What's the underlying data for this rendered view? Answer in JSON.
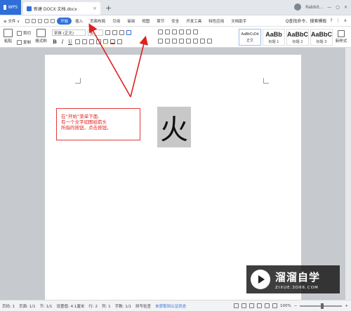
{
  "tabs": {
    "app_label": "WPS",
    "doc_label": "新建 DOCX 文档.docx",
    "close_glyph": "×",
    "add_glyph": "+"
  },
  "window": {
    "user": "Rabbit...",
    "restore_glyph": "▢",
    "minimize_glyph": "—",
    "close_glyph": "×"
  },
  "menu": {
    "file": "≡ 文件 ∨",
    "items": [
      "开始",
      "插入",
      "页面布局",
      "引用",
      "审阅",
      "视图",
      "章节",
      "安全",
      "开发工具",
      "特色应用",
      "文档助手"
    ],
    "search": "Q查找命令、搜索模板",
    "help": "?",
    "more": "⋮",
    "collapse": "∧"
  },
  "ribbon": {
    "paste": "粘贴",
    "cut": "剪切",
    "copy": "复制",
    "format_painter": "格式刷",
    "font_name": "宋体 (正文)",
    "font_size": "五",
    "bold": "B",
    "italic": "I",
    "underline": "U",
    "styles": [
      {
        "sample": "AaBbCcDd",
        "name": "正文"
      },
      {
        "sample": "AaBb",
        "name": "标题 1"
      },
      {
        "sample": "AaBbC",
        "name": "标题 2"
      },
      {
        "sample": "AaBbC",
        "name": "标题 3"
      }
    ],
    "new_style": "新样式"
  },
  "document": {
    "callout_lines": [
      "在“开始”菜单下面,",
      "有一个文字如图纸箭头",
      "所指的按钮，点击按钮。"
    ],
    "fire_char": "火"
  },
  "watermark": {
    "brand": "溜溜自学",
    "url": "ZIXUE.3D66.COM"
  },
  "status": {
    "page": "页码: 1",
    "pages": "页面: 1/1",
    "section": "节: 1/1",
    "position": "设置值: 4.1厘米",
    "row": "行: 2",
    "col": "列: 1",
    "words": "字数: 1/1",
    "spellcheck": "拼写检查",
    "cert": "未获取到认证状态",
    "zoom": "100%",
    "zoom_minus": "−",
    "zoom_plus": "+"
  },
  "colors": {
    "accent": "#2f6ed8",
    "annotation_red": "#e02020"
  }
}
